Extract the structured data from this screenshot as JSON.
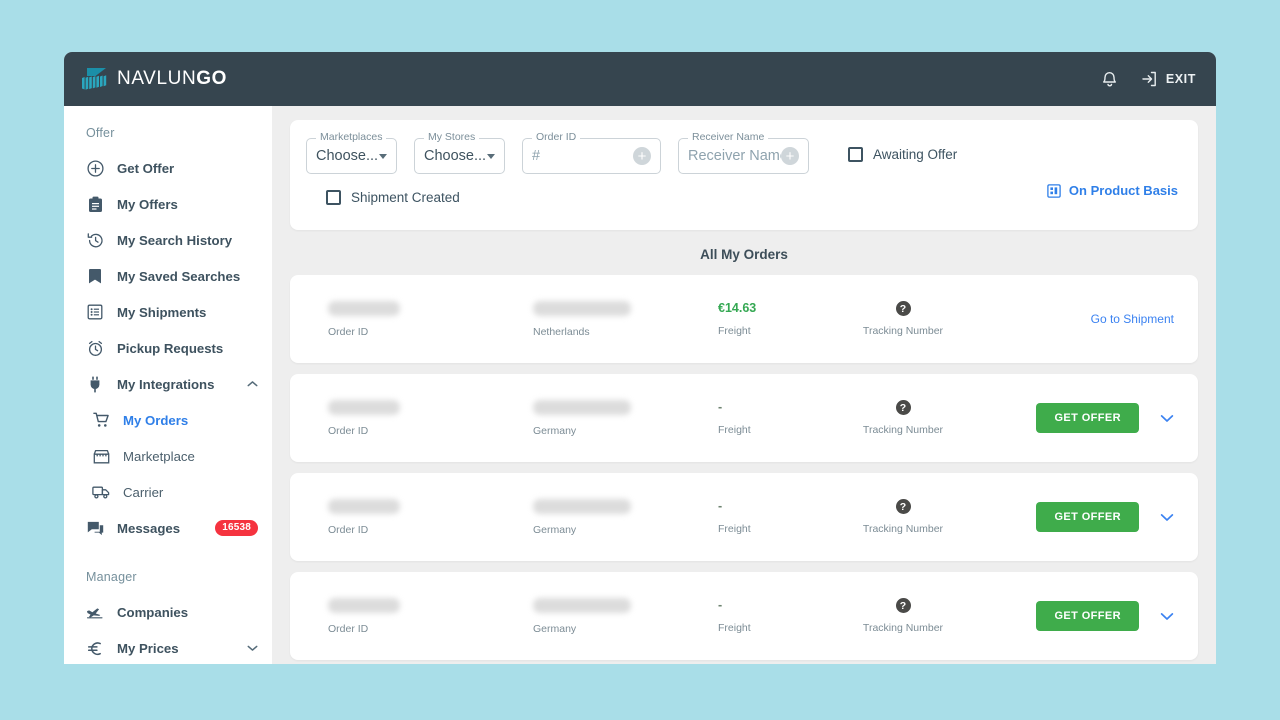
{
  "header": {
    "brand_prefix": "NAVLUN",
    "brand_suffix": "GO",
    "bell_icon": "bell-icon",
    "exit_icon": "exit-icon",
    "exit_label": "EXIT"
  },
  "sidebar": {
    "sections": [
      {
        "label": "Offer",
        "items": [
          {
            "label": "Get Offer",
            "icon": "plus-circle-icon",
            "active": false
          },
          {
            "label": "My Offers",
            "icon": "clipboard-icon",
            "active": false
          },
          {
            "label": "My Search History",
            "icon": "history-icon",
            "active": false
          },
          {
            "label": "My Saved Searches",
            "icon": "bookmark-icon",
            "active": false
          },
          {
            "label": "My Shipments",
            "icon": "list-box-icon",
            "active": false
          },
          {
            "label": "Pickup Requests",
            "icon": "alarm-clock-icon",
            "active": false
          },
          {
            "label": "My Integrations",
            "icon": "plug-icon",
            "active": false,
            "caret": "chevron-up-icon"
          },
          {
            "label": "My Orders",
            "icon": "cart-icon",
            "active": true,
            "sub": true
          },
          {
            "label": "Marketplace",
            "icon": "storefront-icon",
            "active": false,
            "sub": true
          },
          {
            "label": "Carrier",
            "icon": "truck-icon",
            "active": false,
            "sub": true
          },
          {
            "label": "Messages",
            "icon": "chat-icon",
            "active": false,
            "badge": "16538"
          }
        ]
      },
      {
        "label": "Manager",
        "items": [
          {
            "label": "Companies",
            "icon": "plane-icon",
            "active": false
          },
          {
            "label": "My Prices",
            "icon": "euro-icon",
            "active": false,
            "caret": "chevron-down-icon"
          }
        ]
      }
    ]
  },
  "filters": {
    "marketplaces": {
      "label": "Marketplaces",
      "value": "Choose...",
      "icon": "chevron-down-icon"
    },
    "my_stores": {
      "label": "My Stores",
      "value": "Choose...",
      "icon": "chevron-down-icon"
    },
    "order_id": {
      "label": "Order ID",
      "placeholder": "#",
      "add_icon": "plus-circle-icon"
    },
    "receiver": {
      "label": "Receiver Name",
      "placeholder": "Receiver Name",
      "add_icon": "plus-circle-icon"
    },
    "awaiting_offer": {
      "label": "Awaiting Offer",
      "checked": false
    },
    "shipment_created": {
      "label": "Shipment Created",
      "checked": false
    },
    "product_basis": {
      "label": "On Product Basis",
      "icon": "grid-table-icon"
    }
  },
  "main": {
    "title": "All My Orders",
    "labels": {
      "order_id": "Order ID",
      "freight": "Freight",
      "tracking_number": "Tracking Number",
      "tracking_icon": "question-mark-icon"
    },
    "orders": [
      {
        "order_id_value": "",
        "destination": "Netherlands",
        "freight": "€14.63",
        "freight_state": "price",
        "action_type": "link",
        "action_label": "Go to Shipment"
      },
      {
        "order_id_value": "",
        "destination": "Germany",
        "freight": "-",
        "freight_state": "empty",
        "action_type": "button",
        "action_label": "GET OFFER",
        "expand_icon": "chevron-down-icon"
      },
      {
        "order_id_value": "",
        "destination": "Germany",
        "freight": "-",
        "freight_state": "empty",
        "action_type": "button",
        "action_label": "GET OFFER",
        "expand_icon": "chevron-down-icon"
      },
      {
        "order_id_value": "",
        "destination": "Germany",
        "freight": "-",
        "freight_state": "empty",
        "action_type": "button",
        "action_label": "GET OFFER",
        "expand_icon": "chevron-down-icon"
      }
    ]
  },
  "colors": {
    "page_background": "#a9dee8",
    "topbar": "#36454f",
    "content_background": "#eeeeee",
    "accent_blue": "#2f7fe8",
    "accent_green": "#3fac4b",
    "badge_red": "#f5333f",
    "brand_teal": "#2196ad"
  }
}
